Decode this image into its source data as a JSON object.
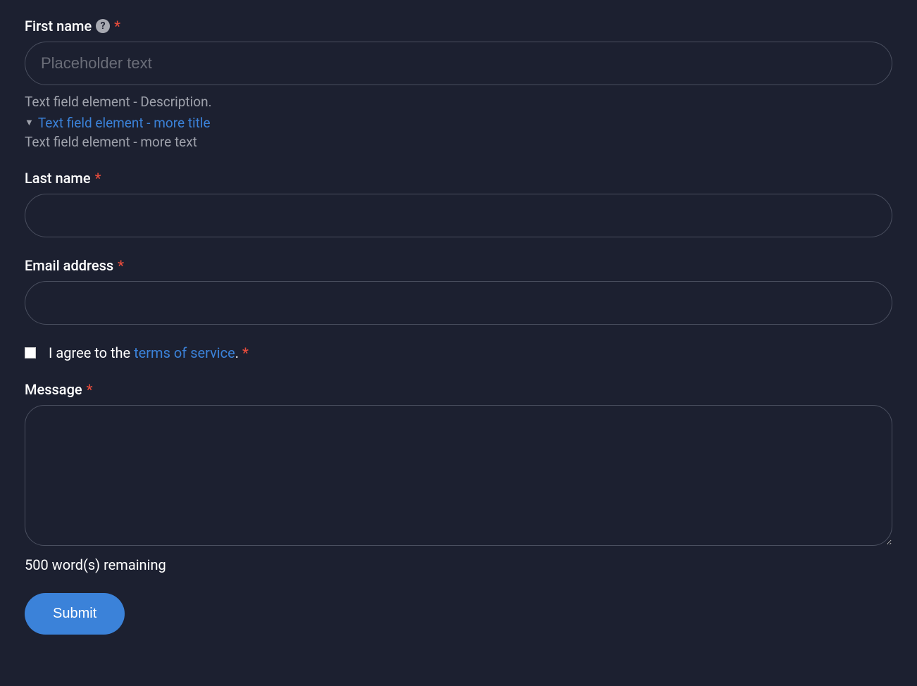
{
  "form": {
    "first_name": {
      "label": "First name",
      "required_marker": "*",
      "help_icon": "?",
      "placeholder": "Placeholder text",
      "description": "Text field element - Description.",
      "more_title": "Text field element - more title",
      "more_text": "Text field element - more text"
    },
    "last_name": {
      "label": "Last name",
      "required_marker": "*"
    },
    "email": {
      "label": "Email address",
      "required_marker": "*"
    },
    "agree": {
      "prefix": "I agree to the ",
      "link_text": "terms of service",
      "suffix": ".",
      "required_marker": "*"
    },
    "message": {
      "label": "Message",
      "required_marker": "*",
      "word_count_text": "500 word(s) remaining"
    },
    "submit_label": "Submit"
  }
}
